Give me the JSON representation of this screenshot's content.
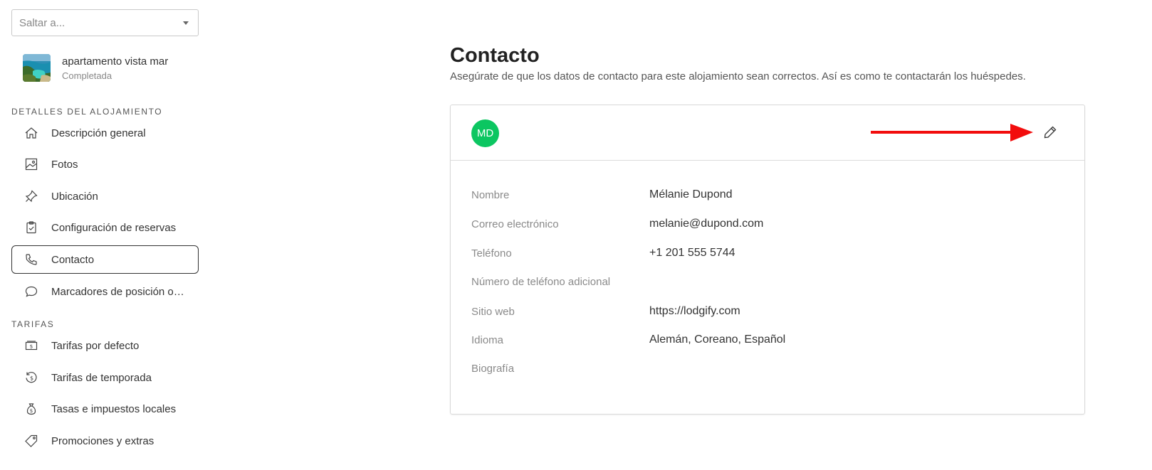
{
  "jump": {
    "placeholder": "Saltar a..."
  },
  "property": {
    "name": "apartamento vista mar",
    "status": "Completada"
  },
  "sections": [
    {
      "title": "DETALLES DEL ALOJAMIENTO",
      "items": [
        {
          "label": "Descripción general",
          "icon": "home-icon"
        },
        {
          "label": "Fotos",
          "icon": "photo-icon"
        },
        {
          "label": "Ubicación",
          "icon": "pin-icon"
        },
        {
          "label": "Configuración de reservas",
          "icon": "clipboard-check-icon"
        },
        {
          "label": "Contacto",
          "icon": "phone-icon",
          "active": true
        },
        {
          "label": "Marcadores de posición op…",
          "icon": "chat-bubble-icon"
        }
      ]
    },
    {
      "title": "TARIFAS",
      "items": [
        {
          "label": "Tarifas por defecto",
          "icon": "cash-icon"
        },
        {
          "label": "Tarifas de temporada",
          "icon": "seasonal-rate-icon"
        },
        {
          "label": "Tasas e impuestos locales",
          "icon": "money-bag-icon"
        },
        {
          "label": "Promociones y extras",
          "icon": "tag-icon"
        }
      ]
    }
  ],
  "main": {
    "title": "Contacto",
    "description": "Asegúrate de que los datos de contacto para este alojamiento sean correctos. Así es como te contactarán los huéspedes."
  },
  "contact": {
    "initials": "MD",
    "avatar_color": "#0cc661",
    "arrow_color": "#f20d0d",
    "rows": [
      {
        "label": "Nombre",
        "value": "Mélanie Dupond"
      },
      {
        "label": "Correo electrónico",
        "value": "melanie@dupond.com"
      },
      {
        "label": "Teléfono",
        "value": "+1 201 555 5744"
      },
      {
        "label": "Número de teléfono adicional",
        "value": ""
      },
      {
        "label": "Sitio web",
        "value": "https://lodgify.com"
      },
      {
        "label": "Idioma",
        "value": "Alemán, Coreano, Español"
      },
      {
        "label": "Biografía",
        "value": ""
      }
    ]
  }
}
